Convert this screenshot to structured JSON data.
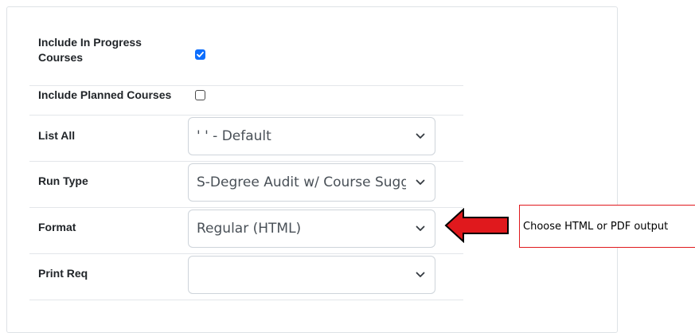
{
  "form": {
    "include_in_progress": {
      "label": "Include In Progress Courses",
      "checked": true
    },
    "include_planned": {
      "label": "Include Planned Courses",
      "checked": false
    },
    "list_all": {
      "label": "List All",
      "selected": "' ' - Default"
    },
    "run_type": {
      "label": "Run Type",
      "selected": "S-Degree Audit w/ Course Suggestions"
    },
    "format": {
      "label": "Format",
      "selected": "Regular (HTML)"
    },
    "print_req": {
      "label": "Print Req",
      "selected": ""
    }
  },
  "annotation": {
    "text": "Choose HTML or PDF output",
    "arrow_color": "#e0191d",
    "arrow_outline": "#000000"
  },
  "colors": {
    "checkbox_checked": "#0d6efd",
    "select_border": "#ced4da",
    "panel_border": "#dee2e6"
  },
  "icons": {
    "checkbox": "checkmark-icon",
    "select": "chevron-down-icon",
    "annotation": "left-arrow-icon"
  }
}
